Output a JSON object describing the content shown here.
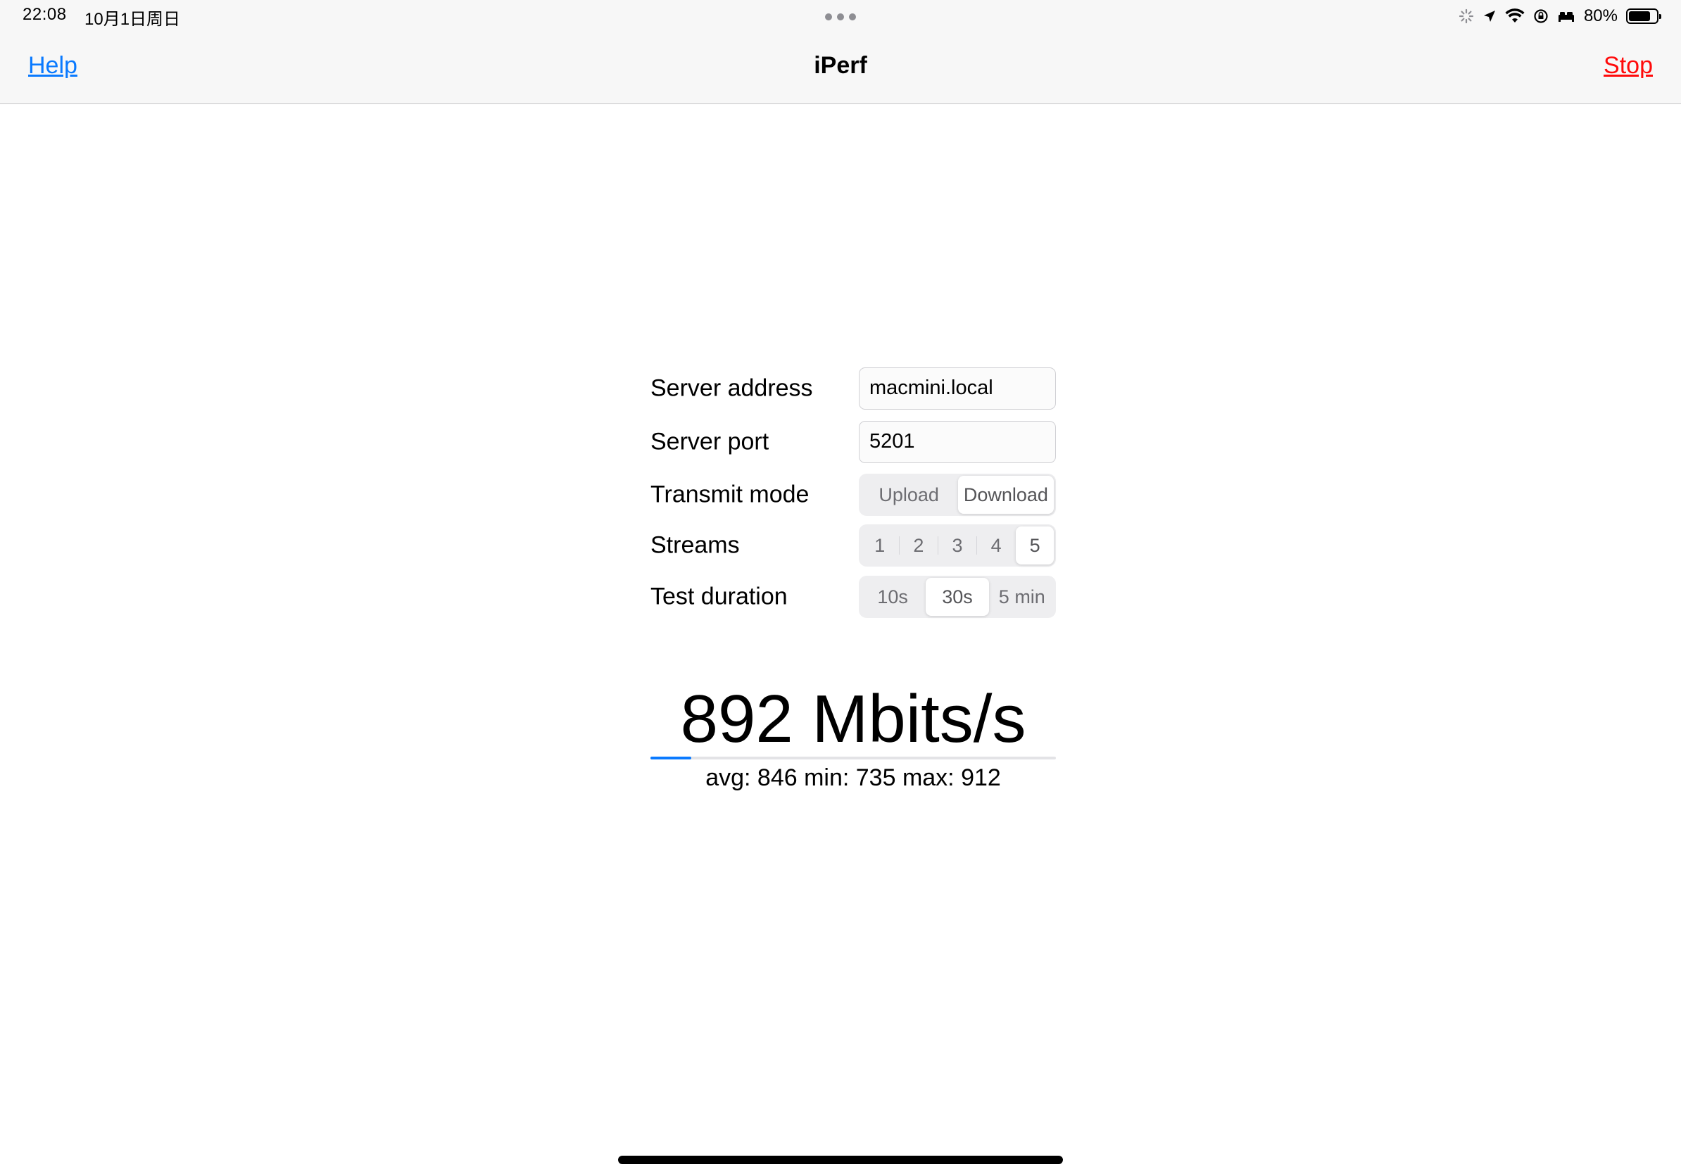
{
  "status_bar": {
    "time": "22:08",
    "date": "10月1日周日",
    "battery_percent": "80%",
    "battery_level": 0.8,
    "icons": [
      "loading-spinner-icon",
      "location-arrow-icon",
      "wifi-icon",
      "screen-lock-rotation-icon",
      "sleep-bed-icon",
      "battery-icon"
    ]
  },
  "nav": {
    "help_label": "Help",
    "title": "iPerf",
    "stop_label": "Stop"
  },
  "form": {
    "server_address": {
      "label": "Server address",
      "value": "macmini.local"
    },
    "server_port": {
      "label": "Server port",
      "value": "5201"
    },
    "transmit_mode": {
      "label": "Transmit mode",
      "options": [
        "Upload",
        "Download"
      ],
      "selected": "Download"
    },
    "streams": {
      "label": "Streams",
      "options": [
        "1",
        "2",
        "3",
        "4",
        "5"
      ],
      "selected": "5"
    },
    "test_duration": {
      "label": "Test duration",
      "options": [
        "10s",
        "30s",
        "5 min"
      ],
      "selected": "30s"
    }
  },
  "result": {
    "speed": "892 Mbits/s",
    "stats": "avg: 846 min: 735 max: 912",
    "progress": 0.1
  },
  "colors": {
    "accent": "#0a7aff",
    "stop": "#ff0a0a"
  }
}
